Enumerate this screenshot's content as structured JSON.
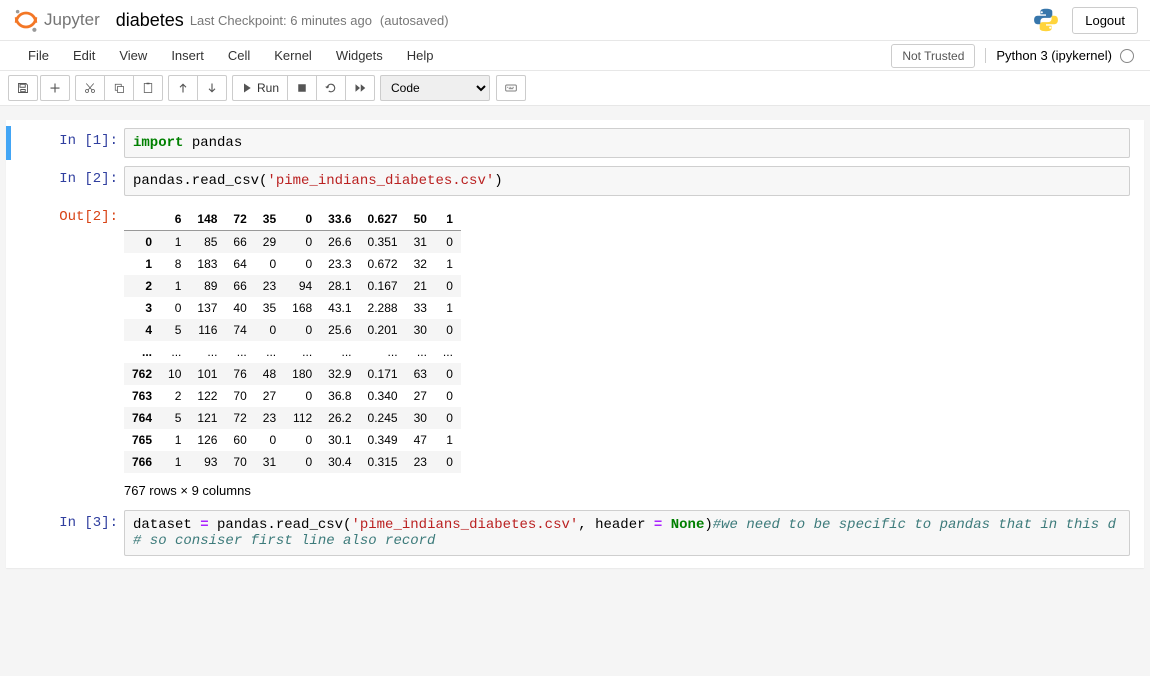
{
  "header": {
    "logo_text": "Jupyter",
    "title": "diabetes",
    "checkpoint": "Last Checkpoint: 6 minutes ago",
    "autosaved": "(autosaved)",
    "logout": "Logout"
  },
  "menu": {
    "items": [
      "File",
      "Edit",
      "View",
      "Insert",
      "Cell",
      "Kernel",
      "Widgets",
      "Help"
    ],
    "trust": "Not Trusted",
    "kernel": "Python 3 (ipykernel)"
  },
  "toolbar": {
    "run": "Run",
    "celltype": "Code"
  },
  "cells": {
    "c1": {
      "prompt": "In [1]:",
      "kw": "import",
      "rest": " pandas"
    },
    "c2": {
      "prompt": "In [2]:",
      "pre": "pandas.read_csv(",
      "str": "'pime_indians_diabetes.csv'",
      "post": ")"
    },
    "out2": {
      "prompt": "Out[2]:"
    },
    "c3": {
      "prompt": "In [3]:",
      "p1": "dataset ",
      "op": "=",
      "p2": " pandas.read_csv(",
      "s1": "'pime_indians_diabetes.csv'",
      "p3": ", header ",
      "op2": "=",
      "p4": " ",
      "none": "None",
      "p5": ")",
      "cmt1": "#we need to be specific to pandas that in this d",
      "cmt2": "# so consiser first line also record"
    }
  },
  "df": {
    "headers": [
      "6",
      "148",
      "72",
      "35",
      "0",
      "33.6",
      "0.627",
      "50",
      "1"
    ],
    "rows": [
      {
        "idx": "0",
        "v": [
          "1",
          "85",
          "66",
          "29",
          "0",
          "26.6",
          "0.351",
          "31",
          "0"
        ]
      },
      {
        "idx": "1",
        "v": [
          "8",
          "183",
          "64",
          "0",
          "0",
          "23.3",
          "0.672",
          "32",
          "1"
        ]
      },
      {
        "idx": "2",
        "v": [
          "1",
          "89",
          "66",
          "23",
          "94",
          "28.1",
          "0.167",
          "21",
          "0"
        ]
      },
      {
        "idx": "3",
        "v": [
          "0",
          "137",
          "40",
          "35",
          "168",
          "43.1",
          "2.288",
          "33",
          "1"
        ]
      },
      {
        "idx": "4",
        "v": [
          "5",
          "116",
          "74",
          "0",
          "0",
          "25.6",
          "0.201",
          "30",
          "0"
        ]
      },
      {
        "idx": "...",
        "v": [
          "...",
          "...",
          "...",
          "...",
          "...",
          "...",
          "...",
          "...",
          "..."
        ]
      },
      {
        "idx": "762",
        "v": [
          "10",
          "101",
          "76",
          "48",
          "180",
          "32.9",
          "0.171",
          "63",
          "0"
        ]
      },
      {
        "idx": "763",
        "v": [
          "2",
          "122",
          "70",
          "27",
          "0",
          "36.8",
          "0.340",
          "27",
          "0"
        ]
      },
      {
        "idx": "764",
        "v": [
          "5",
          "121",
          "72",
          "23",
          "112",
          "26.2",
          "0.245",
          "30",
          "0"
        ]
      },
      {
        "idx": "765",
        "v": [
          "1",
          "126",
          "60",
          "0",
          "0",
          "30.1",
          "0.349",
          "47",
          "1"
        ]
      },
      {
        "idx": "766",
        "v": [
          "1",
          "93",
          "70",
          "31",
          "0",
          "30.4",
          "0.315",
          "23",
          "0"
        ]
      }
    ],
    "caption": "767 rows × 9 columns"
  }
}
